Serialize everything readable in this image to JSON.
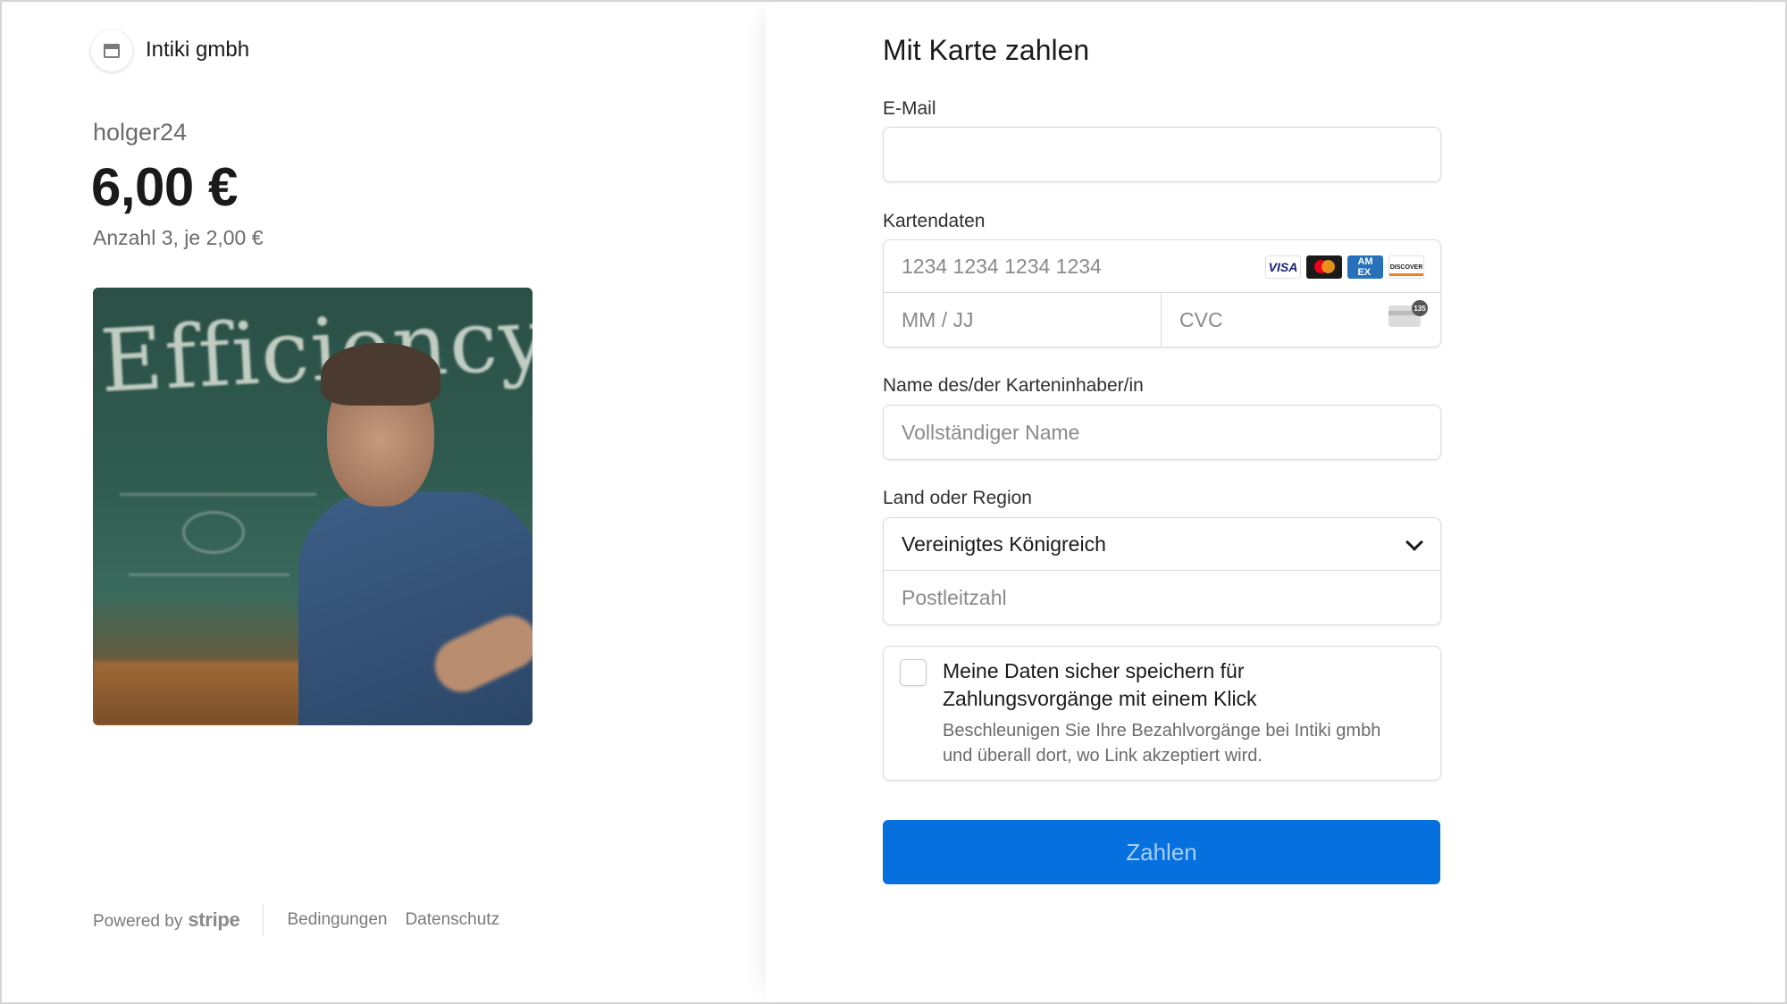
{
  "merchant": {
    "name": "Intiki gmbh",
    "logo_icon": "store-icon"
  },
  "product": {
    "name": "holger24",
    "price": "6,00 €",
    "quantity_text": "Anzahl 3, je 2,00 €",
    "image_board_text": "Efficiency"
  },
  "footer": {
    "powered_by": "Powered by",
    "stripe": "stripe",
    "terms": "Bedingungen",
    "privacy": "Datenschutz"
  },
  "form": {
    "title": "Mit Karte zahlen",
    "email_label": "E-Mail",
    "email_value": "",
    "card_label": "Kartendaten",
    "card_number_placeholder": "1234 1234 1234 1234",
    "card_brands": [
      "VISA",
      "Mastercard",
      "AMEX",
      "DISCOVER"
    ],
    "expiry_placeholder": "MM / JJ",
    "cvc_placeholder": "CVC",
    "cvc_badge": "135",
    "name_label": "Name des/der Karteninhaber/in",
    "name_placeholder": "Vollständiger Name",
    "region_label": "Land oder Region",
    "region_value": "Vereinigtes Königreich",
    "postal_placeholder": "Postleitzahl",
    "save_title": "Meine Daten sicher speichern für Zahlungsvorgänge mit einem Klick",
    "save_description": "Beschleunigen Sie Ihre Bezahlvorgänge bei Intiki gmbh und überall dort, wo Link akzeptiert wird.",
    "save_checked": false,
    "pay_button": "Zahlen"
  },
  "colors": {
    "accent": "#0570de",
    "pay_text": "#a9cdf5",
    "muted_text": "#6b6b6b",
    "border": "#dadada"
  }
}
